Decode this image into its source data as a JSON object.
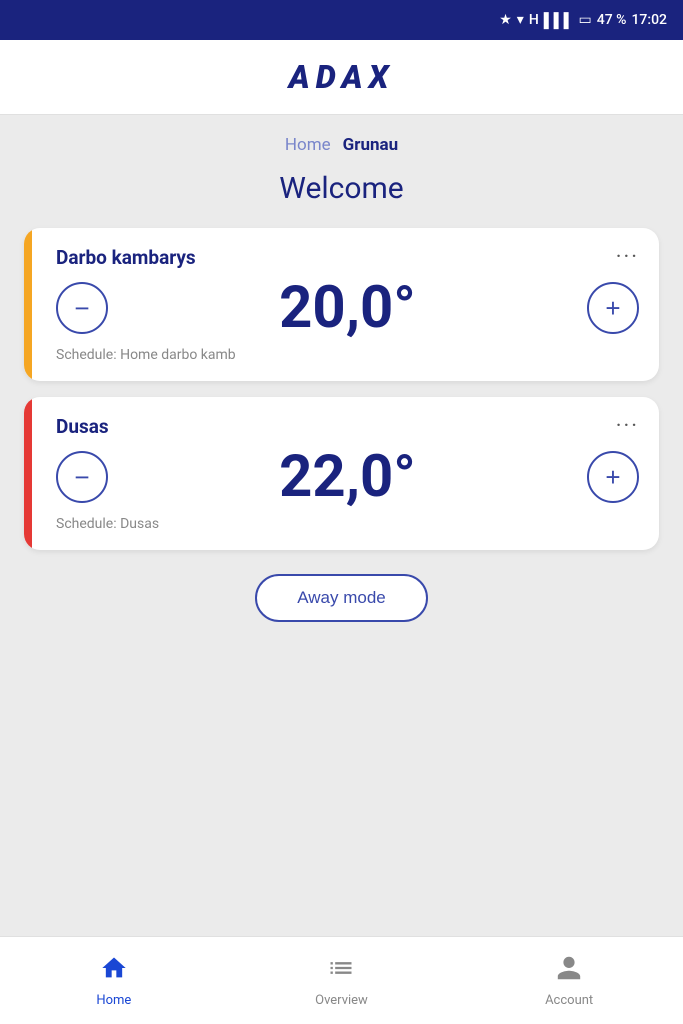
{
  "statusBar": {
    "battery": "47 %",
    "time": "17:02"
  },
  "header": {
    "logo": "ADAX"
  },
  "locationNav": {
    "home": "Home",
    "active": "Grunau"
  },
  "welcomeTitle": "Welcome",
  "devices": [
    {
      "id": "darbo",
      "name": "Darbo kambarys",
      "temperature": "20,0°",
      "schedule": "Schedule: Home darbo kamb",
      "barColor": "bar-yellow"
    },
    {
      "id": "dusas",
      "name": "Dusas",
      "temperature": "22,0°",
      "schedule": "Schedule: Dusas",
      "barColor": "bar-orange"
    }
  ],
  "awayModeButton": "Away mode",
  "bottomNav": {
    "items": [
      {
        "id": "home",
        "label": "Home",
        "active": true
      },
      {
        "id": "overview",
        "label": "Overview",
        "active": false
      },
      {
        "id": "account",
        "label": "Account",
        "active": false
      }
    ]
  }
}
